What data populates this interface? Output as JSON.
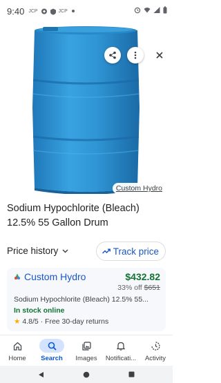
{
  "status_bar": {
    "time": "9:40",
    "notif_1": "JCP",
    "notif_2": "JCP"
  },
  "image": {
    "source_label": "Custom Hydro",
    "barrel_color": "#2a8fd0"
  },
  "product": {
    "title": "Sodium Hypochlorite (Bleach) 12.5% 55 Gallon Drum"
  },
  "price_history": {
    "label": "Price history",
    "track_label": "Track price"
  },
  "offer": {
    "merchant": "Custom Hydro",
    "price": "$432.82",
    "discount_prefix": "33% off",
    "old_price": "$651",
    "description": "Sodium Hypochlorite (Bleach) 12.5% 55...",
    "stock": "In stock online",
    "rating": "4.8/5 · Free 30-day returns"
  },
  "nav": {
    "items": [
      {
        "label": "Home",
        "icon": "home-icon"
      },
      {
        "label": "Search",
        "icon": "search-icon"
      },
      {
        "label": "Images",
        "icon": "images-icon"
      },
      {
        "label": "Notificati...",
        "icon": "bell-icon"
      },
      {
        "label": "Activity",
        "icon": "activity-icon"
      }
    ]
  },
  "colors": {
    "link_blue": "#1a56c4",
    "price_green": "#137333",
    "active_pill": "#d3e3fd"
  }
}
